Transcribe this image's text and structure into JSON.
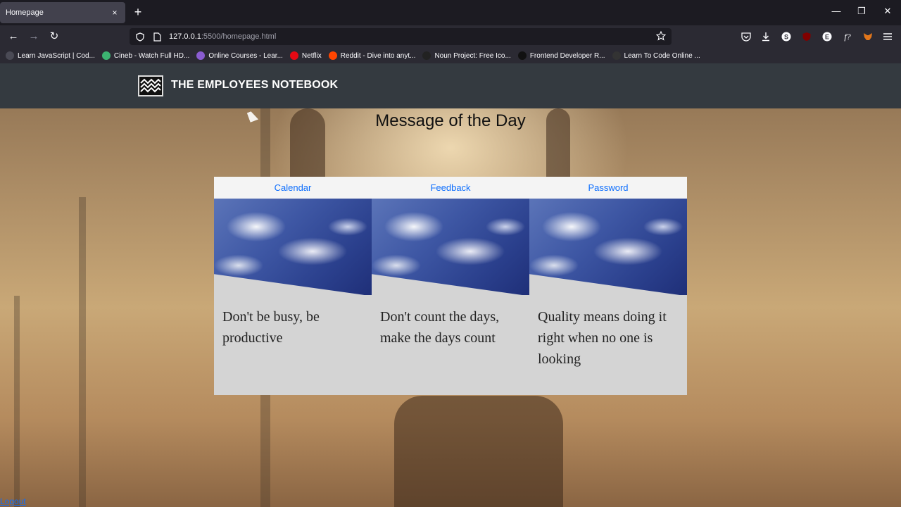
{
  "browser": {
    "tab_title": "Homepage",
    "tab_close": "×",
    "new_tab": "+",
    "url_host": "127.0.0.1",
    "url_path": ":5500/homepage.html",
    "window_controls": {
      "minimize": "—",
      "restore": "❐",
      "close": "✕"
    },
    "nav": {
      "back": "←",
      "forward": "→",
      "reload": "↻"
    },
    "bookmarks": [
      {
        "label": "Learn JavaScript | Cod...",
        "color": "#4a4a55"
      },
      {
        "label": "Cineb - Watch Full HD...",
        "color": "#3cb371"
      },
      {
        "label": "Online Courses - Lear...",
        "color": "#8a5cd1"
      },
      {
        "label": "Netflix",
        "color": "#e50914"
      },
      {
        "label": "Reddit - Dive into anyt...",
        "color": "#ff4500"
      },
      {
        "label": "Noun Project: Free Ico...",
        "color": "#222222"
      },
      {
        "label": "Frontend Developer R...",
        "color": "#111111"
      },
      {
        "label": "Learn To Code Online ...",
        "color": "#333333"
      }
    ]
  },
  "site": {
    "brand": "THE EMPLOYEES NOTEBOOK",
    "heading": "Message of the Day",
    "cards": [
      {
        "link": "Calendar",
        "quote": "Don't be busy, be productive"
      },
      {
        "link": "Feedback",
        "quote": "Don't count the days, make the days count"
      },
      {
        "link": "Password",
        "quote": "Quality means doing it right when no one is looking"
      }
    ],
    "logout": "Logout"
  },
  "colors": {
    "header_bg": "#343a40",
    "link": "#0d6efd",
    "card_bg": "#d4d4d4"
  }
}
